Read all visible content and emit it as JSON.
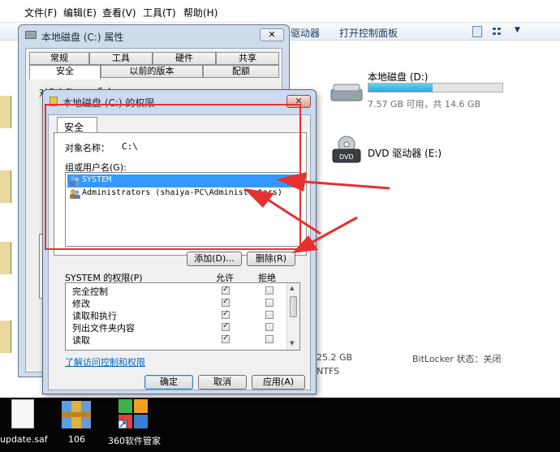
{
  "explorer": {
    "menu": [
      "文件(F)",
      "编辑(E)",
      "查看(V)",
      "工具(T)",
      "帮助(H)"
    ],
    "toolbar": {
      "drivers": "驱动器",
      "open_control_panel": "打开控制面板"
    },
    "drives": [
      {
        "name": "本地磁盘 (D:)",
        "sub": "7.57 GB 可用，共 14.6 GB",
        "used_fraction": 0.48
      },
      {
        "name": "DVD 驱动器 (E:)"
      }
    ],
    "status": {
      "size_fragment": "25.2 GB",
      "fs_fragment": "NTFS",
      "bitlocker": "BitLocker 状态：关闭"
    }
  },
  "props_dialog": {
    "title": "本地磁盘 (C:) 属性",
    "close": "✕",
    "tabs_row1": [
      "常规",
      "工具",
      "硬件",
      "共享"
    ],
    "tabs_row2": [
      "安全",
      "以前的版本",
      "配额"
    ],
    "frag_object": "对象名称：",
    "frag_object_value": "C:\\"
  },
  "perm_dialog": {
    "title": "本地磁盘 (C:) 的权限",
    "close": "✕",
    "tab": "安全",
    "object_label": "对象名称：",
    "object_value": "C:\\",
    "group_label": "组或用户名(G):",
    "users": [
      {
        "name": "SYSTEM",
        "selected": true
      },
      {
        "name": "Administrators (shaiya-PC\\Administrators)",
        "selected": false
      }
    ],
    "add_button": "添加(D)...",
    "remove_button": "删除(R)",
    "perm_label": "SYSTEM 的权限(P)",
    "allow_header": "允许",
    "deny_header": "拒绝",
    "permissions": [
      {
        "name": "完全控制",
        "allow": true,
        "deny": false
      },
      {
        "name": "修改",
        "allow": true,
        "deny": false
      },
      {
        "name": "读取和执行",
        "allow": true,
        "deny": false
      },
      {
        "name": "列出文件夹内容",
        "allow": true,
        "deny": false
      },
      {
        "name": "读取",
        "allow": true,
        "deny": false
      }
    ],
    "learn_link": "了解访问控制和权限",
    "ok_button": "确定",
    "cancel_button": "取消",
    "apply_button": "应用(A)"
  },
  "desktop": {
    "left_labels": [
      "新",
      "新",
      "Ne"
    ],
    "shortcuts": [
      {
        "label": "update.saf",
        "icon": "blank-file-icon"
      },
      {
        "label": "106",
        "icon": "winrar-archive-icon"
      },
      {
        "label": "360软件管家",
        "icon": "360-software-manager-icon"
      }
    ]
  },
  "colors": {
    "selection": "#3399ff",
    "annotation_red": "#e53030",
    "link": "#0066cc"
  }
}
